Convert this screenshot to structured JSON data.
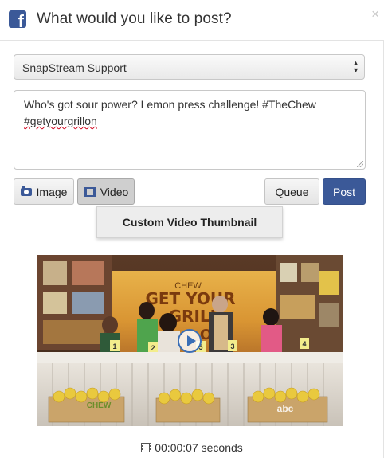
{
  "header": {
    "title": "What would you like to post?",
    "close_glyph": "×"
  },
  "account_select": {
    "value": "SnapStream Support"
  },
  "post_text": {
    "line1": "Who's got sour power? Lemon press challenge! #TheChew",
    "line2": "#getyourgrillon"
  },
  "toolbar": {
    "image_label": "Image",
    "video_label": "Video",
    "queue_label": "Queue",
    "post_label": "Post"
  },
  "video_menu": {
    "custom_thumbnail_label": "Custom Video Thumbnail"
  },
  "video_preview": {
    "duration_text": "00:00:07 seconds",
    "overlay_text_1": "CHEW",
    "overlay_text_2": "GET YOUR",
    "overlay_text_3": "GRILL",
    "overlay_text_4": "ON",
    "watermark_chew": "CHEW",
    "watermark_network": "abc",
    "contestant_numbers": [
      "1",
      "2",
      "3",
      "4",
      "5"
    ]
  },
  "colors": {
    "brand": "#3b5998",
    "play_ring": "#3b6fb6",
    "spellcheck": "#d0021b"
  },
  "icons": {
    "header": "facebook-logo-icon",
    "image": "camera-icon",
    "video": "film-icon",
    "duration": "film-strip-icon",
    "play": "play-icon",
    "select": "up-down-arrows-icon"
  }
}
